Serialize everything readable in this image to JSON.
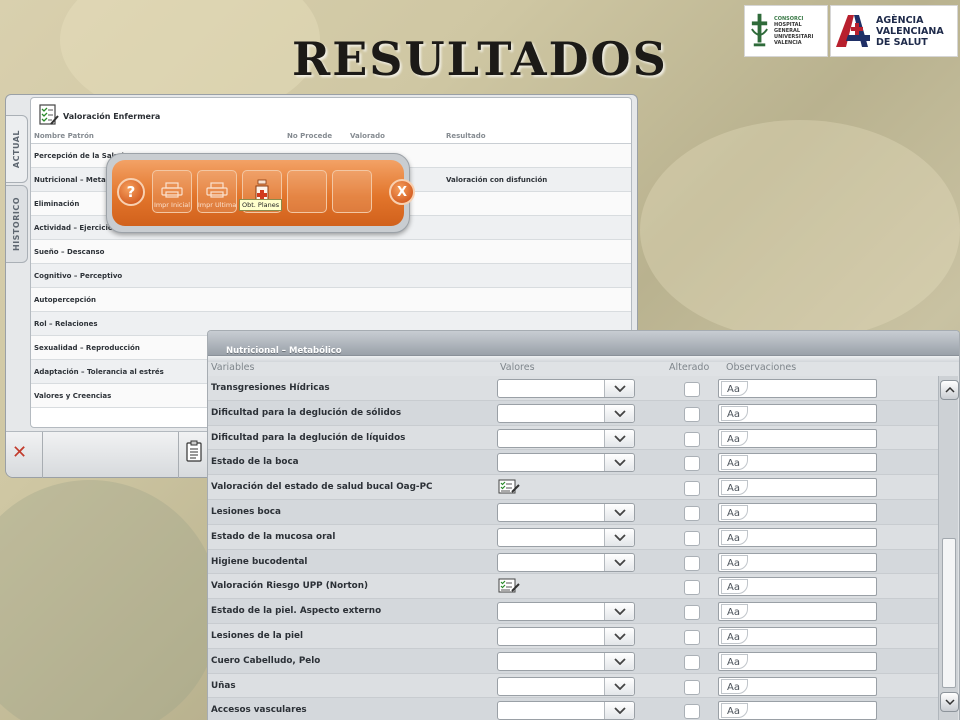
{
  "page": {
    "title": "RESULTADOS"
  },
  "logos": {
    "hospital": [
      "CONSORCI",
      "HOSPITAL GENERAL",
      "UNIVERSITARI",
      "VALENCIA"
    ],
    "agencia": [
      "AGÈNCIA",
      "VALENCIANA",
      "DE SALUT"
    ]
  },
  "back_window": {
    "tabs": [
      "ACTUAL",
      "HISTORICO"
    ],
    "panel_title": "Valoración Enfermera",
    "columns": [
      "Nombre Patrón",
      "No Procede",
      "Valorado",
      "Resultado"
    ],
    "rows": [
      {
        "name": "Percepción de la Salud",
        "resultado": ""
      },
      {
        "name": "Nutricional – Metabólico",
        "resultado": "Valoración con disfunción"
      },
      {
        "name": "Eliminación",
        "resultado": ""
      },
      {
        "name": "Actividad – Ejercicio",
        "resultado": ""
      },
      {
        "name": "Sueño – Descanso",
        "resultado": ""
      },
      {
        "name": "Cognitivo – Perceptivo",
        "resultado": ""
      },
      {
        "name": "Autopercepción",
        "resultado": ""
      },
      {
        "name": "Rol – Relaciones",
        "resultado": ""
      },
      {
        "name": "Sexualidad – Reproducción",
        "resultado": ""
      },
      {
        "name": "Adaptación – Tolerancia al estrés",
        "resultado": ""
      },
      {
        "name": "Valores y Creencias",
        "resultado": ""
      }
    ]
  },
  "toolbar": {
    "help": "?",
    "close": "X",
    "buttons": [
      "Impr Inicial",
      "Impr Ultima",
      "",
      "",
      ""
    ],
    "tooltip": "Obt. Planes"
  },
  "nutri_window": {
    "title": "Nutricional – Metabólico",
    "columns": [
      "Variables",
      "Valores",
      "Alterado",
      "Observaciones"
    ],
    "obs_label": "Aa",
    "rows": [
      {
        "name": "Transgresiones Hídricas",
        "control": "select"
      },
      {
        "name": "Dificultad para la deglución de sólidos",
        "control": "select"
      },
      {
        "name": "Dificultad para la deglución de líquidos",
        "control": "select"
      },
      {
        "name": "Estado de la boca",
        "control": "select"
      },
      {
        "name": "Valoración del estado de salud bucal Oag-PC",
        "control": "form"
      },
      {
        "name": "Lesiones boca",
        "control": "select"
      },
      {
        "name": "Estado de la mucosa oral",
        "control": "select"
      },
      {
        "name": "Higiene bucodental",
        "control": "select"
      },
      {
        "name": "Valoración Riesgo UPP (Norton)",
        "control": "form"
      },
      {
        "name": "Estado de la piel. Aspecto externo",
        "control": "select"
      },
      {
        "name": "Lesiones de la piel",
        "control": "select"
      },
      {
        "name": "Cuero Cabelludo, Pelo",
        "control": "select"
      },
      {
        "name": "Uñas",
        "control": "select"
      },
      {
        "name": "Accesos vasculares",
        "control": "select"
      }
    ]
  }
}
